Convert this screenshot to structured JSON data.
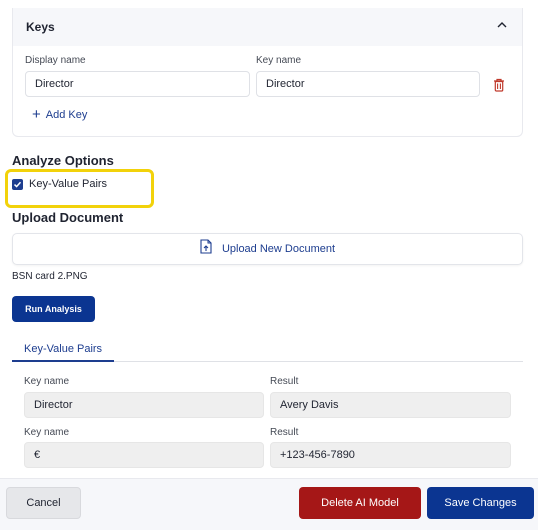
{
  "keys_section": {
    "title": "Keys",
    "display_name_label": "Display name",
    "key_name_label": "Key name",
    "display_name_value": "Director",
    "key_name_value": "Director",
    "add_key_label": "Add Key"
  },
  "analyze_options": {
    "title": "Analyze Options",
    "checkbox_label": "Key-Value Pairs",
    "checked": true
  },
  "upload": {
    "title": "Upload Document",
    "button_label": "Upload New Document",
    "filename": "BSN card 2.PNG"
  },
  "run_analysis_label": "Run Analysis",
  "results_tab_label": "Key-Value Pairs",
  "results": [
    {
      "key_label": "Key name",
      "result_label": "Result",
      "key_value": "Director",
      "result_value": "Avery Davis"
    },
    {
      "key_label": "Key name",
      "result_label": "Result",
      "key_value": "€",
      "result_value": "+123-456-7890"
    }
  ],
  "footer": {
    "cancel_label": "Cancel",
    "delete_label": "Delete AI Model",
    "save_label": "Save Changes"
  },
  "colors": {
    "primary": "#0b3591",
    "danger": "#a51717",
    "highlight": "#f2d20a"
  }
}
